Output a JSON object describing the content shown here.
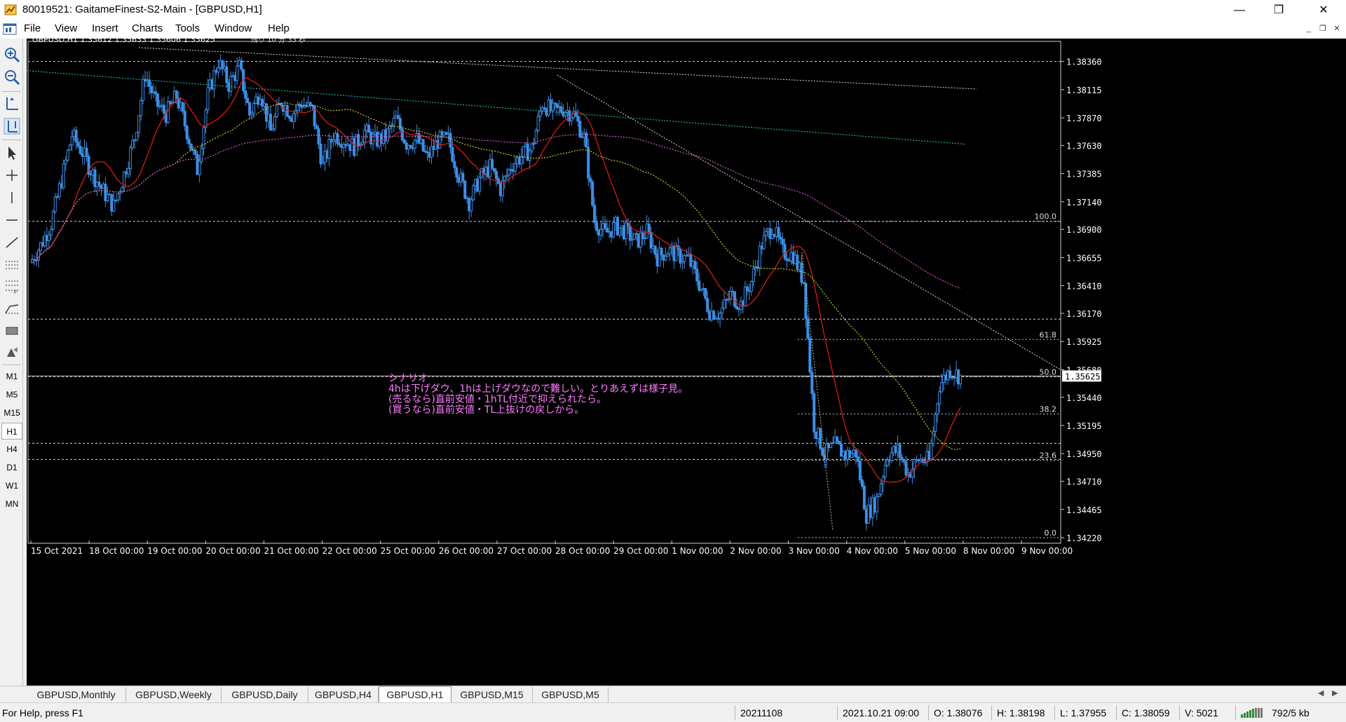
{
  "window": {
    "title": "80019521: GaitameFinest-S2-Main - [GBPUSD,H1]",
    "minimize_glyph": "—",
    "restore_glyph": "❐",
    "close_glyph": "✕"
  },
  "menu": {
    "items": [
      "File",
      "View",
      "Insert",
      "Charts",
      "Tools",
      "Window",
      "Help"
    ]
  },
  "mdi": {
    "min": "_",
    "restore": "❐",
    "close": "✕"
  },
  "toolbar": {
    "tools": [
      "zoom-in-icon",
      "zoom-out-icon",
      "tile-icon",
      "crosshair-cursor-icon",
      "cursor-icon",
      "crosshair-icon",
      "vertical-line-icon",
      "horizontal-line-icon",
      "trendline-icon",
      "equidistant-channel-icon",
      "fibonacci-icon",
      "gann-icon",
      "rectangle-icon",
      "shapes-icon"
    ],
    "timeframes": [
      "M1",
      "M5",
      "M15",
      "H1",
      "H4",
      "D1",
      "W1",
      "MN"
    ],
    "active_timeframe": "H1"
  },
  "chart": {
    "header": "GBPUSD,H1  1.35612 1.35633 1.35606 1.35625",
    "countdown": "残り 10 分 33 秒",
    "current_price": "1.35625",
    "fib_labels": [
      "100.0",
      "61.8",
      "50.0",
      "38.2",
      "23.6",
      "0.0"
    ],
    "annotation": [
      "シナリオ",
      "4hは下げダウ、1hは上げダウなので難しい。とりあえずは様子見。",
      "(売るなら)直前安値・1hTL付近で抑えられたら。",
      "(買うなら)直前安値・TL上抜けの戻しから。"
    ],
    "colors": {
      "candle": "#3d8fe6",
      "ma_fast": "#e81c1c",
      "ma_mid": "#cfcf2a",
      "ma_slow": "#d060d0",
      "ma_long": "#1ab0b0",
      "annotation": "#ff7cff"
    }
  },
  "chart_data": {
    "type": "candlestick",
    "symbol": "GBPUSD",
    "timeframe": "H1",
    "ylim": [
      1.3422,
      1.3851
    ],
    "y_ticks": [
      1.3836,
      1.38115,
      1.3787,
      1.3763,
      1.37385,
      1.3714,
      1.369,
      1.36655,
      1.3641,
      1.3617,
      1.35925,
      1.3568,
      1.3544,
      1.35195,
      1.3495,
      1.3471,
      1.34465,
      1.3422
    ],
    "x_ticks": [
      "15 Oct 2021",
      "18 Oct 00:00",
      "19 Oct 00:00",
      "20 Oct 00:00",
      "21 Oct 00:00",
      "22 Oct 00:00",
      "25 Oct 00:00",
      "26 Oct 00:00",
      "27 Oct 00:00",
      "28 Oct 00:00",
      "29 Oct 00:00",
      "1 Nov 00:00",
      "2 Nov 00:00",
      "3 Nov 00:00",
      "4 Nov 00:00",
      "5 Nov 00:00",
      "8 Nov 00:00",
      "9 Nov 00:00"
    ],
    "close_path": [
      1.3661,
      1.3676,
      1.3695,
      1.3733,
      1.3772,
      1.3757,
      1.3738,
      1.3723,
      1.371,
      1.3738,
      1.377,
      1.3825,
      1.38,
      1.379,
      1.3806,
      1.3775,
      1.3742,
      1.3807,
      1.3836,
      1.3816,
      1.3831,
      1.379,
      1.3811,
      1.3775,
      1.3802,
      1.379,
      1.38,
      1.3793,
      1.3745,
      1.3773,
      1.3768,
      1.3762,
      1.3775,
      1.3767,
      1.377,
      1.3786,
      1.3765,
      1.3768,
      1.3752,
      1.3767,
      1.3768,
      1.3737,
      1.3714,
      1.3734,
      1.3744,
      1.3725,
      1.3745,
      1.3754,
      1.376,
      1.38,
      1.3792,
      1.3795,
      1.379,
      1.377,
      1.3697,
      1.3686,
      1.3693,
      1.3688,
      1.3679,
      1.3688,
      1.3666,
      1.3672,
      1.3667,
      1.3664,
      1.3643,
      1.3619,
      1.3617,
      1.3633,
      1.3625,
      1.3645,
      1.3677,
      1.3693,
      1.367,
      1.3668,
      1.3645,
      1.352,
      1.3494,
      1.3502,
      1.3494,
      1.3496,
      1.3442,
      1.3455,
      1.3494,
      1.3498,
      1.3478,
      1.349,
      1.3489,
      1.3555,
      1.3568,
      1.3562
    ],
    "fib_levels": [
      1.3697,
      1.35943,
      1.3562,
      1.35295,
      1.34892,
      1.3422
    ],
    "horizontal_levels": [
      1.3836,
      1.3697,
      1.3612,
      1.3562,
      1.3504,
      1.349
    ]
  },
  "tabs": {
    "items": [
      "GBPUSD,Monthly",
      "GBPUSD,Weekly",
      "GBPUSD,Daily",
      "GBPUSD,H4",
      "GBPUSD,H1",
      "GBPUSD,M15",
      "GBPUSD,M5"
    ],
    "active": "GBPUSD,H1"
  },
  "status": {
    "help": "For Help, press F1",
    "profile": "20211108",
    "datetime": "2021.10.21 09:00",
    "open": "O: 1.38076",
    "high": "H: 1.38198",
    "low": "L: 1.37955",
    "close": "C: 1.38059",
    "volume": "V: 5021",
    "traffic": "792/5 kb"
  }
}
